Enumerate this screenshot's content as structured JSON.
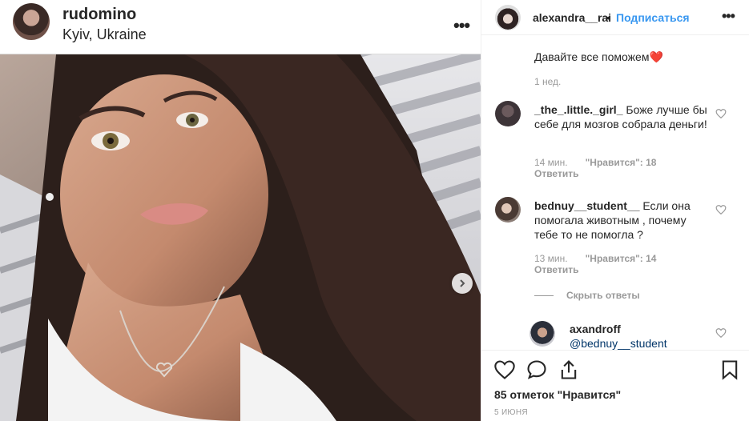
{
  "post": {
    "author": "rudomino",
    "location": "Kyiv, Ukraine",
    "more": "•••"
  },
  "side_header": {
    "username": "alexandra__rai",
    "separator": "•",
    "follow": "Подписаться",
    "more": "•••"
  },
  "comments": {
    "top": {
      "text": "Давайте все поможем",
      "emoji": "❤️",
      "time": "1 нед."
    },
    "items": [
      {
        "username": "_the_.little._girl_",
        "text": "Боже лучше бы себе для мозгов собрала деньги!",
        "time": "14 мин.",
        "likes": "\"Нравится\": 18",
        "reply": "Ответить"
      },
      {
        "username": "bednuy__student__",
        "text": "Если она помогала животным , почему тебе то не помогла ?",
        "time": "13 мин.",
        "likes": "\"Нравится\": 14",
        "reply": "Ответить"
      }
    ],
    "hide_replies": "Скрыть ответы",
    "nested": {
      "username": "axandroff",
      "mention": "@bednuy__student"
    }
  },
  "footer": {
    "likes": "85 отметок \"Нравится\"",
    "date": "5 ИЮНЯ"
  },
  "icons": [
    "heart-icon",
    "comment-icon",
    "share-icon",
    "bookmark-icon",
    "chevron-right-icon"
  ],
  "colors": {
    "link": "#3897f0",
    "muted": "#999999",
    "heart": "#ed4956"
  }
}
